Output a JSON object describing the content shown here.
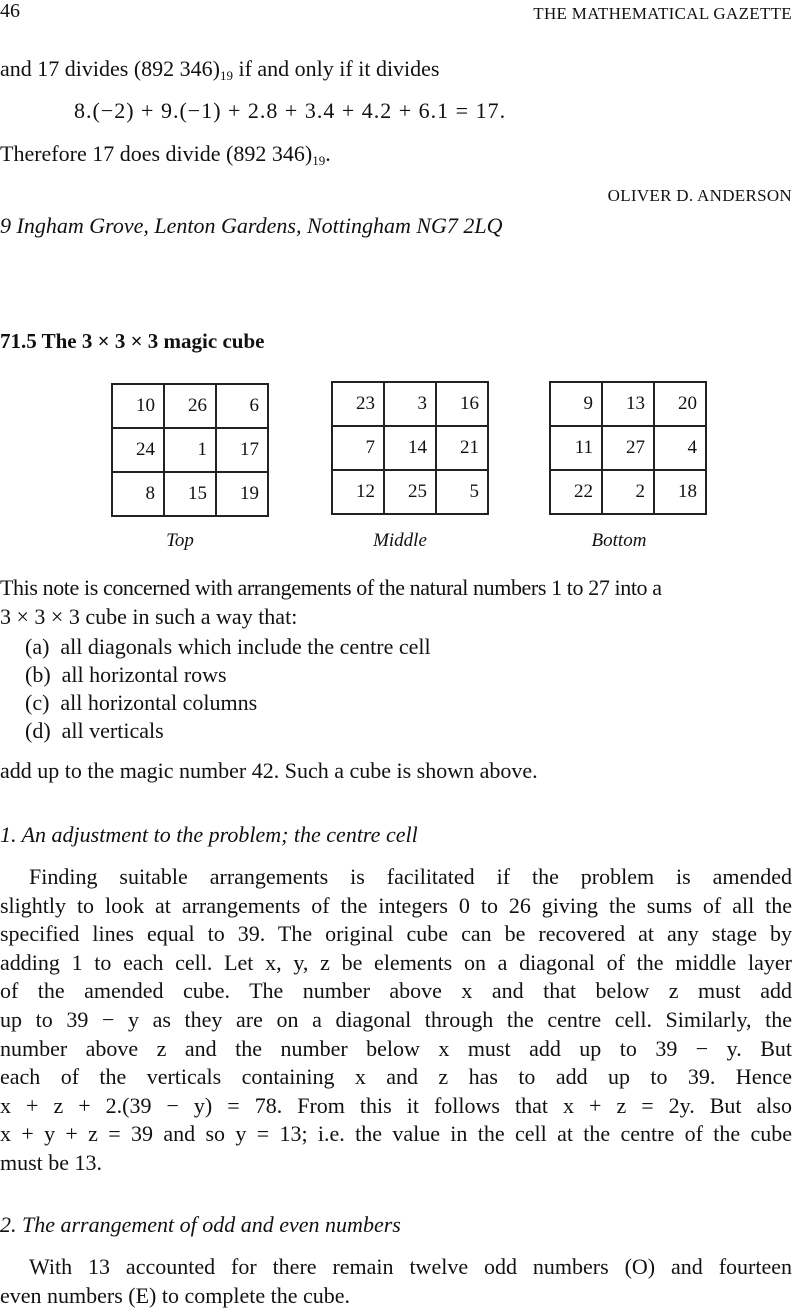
{
  "header": {
    "page_number": "46",
    "journal": "THE MATHEMATICAL GAZETTE"
  },
  "prev_note": {
    "line1_a": "and 17 divides (892 346)",
    "line1_sub": "19",
    "line1_b": " if and only if it divides",
    "equation": "8.(−2) + 9.(−1) + 2.8 + 3.4 + 4.2 + 6.1 = 17.",
    "line3_a": "Therefore 17 does divide (892 346)",
    "line3_sub": "19",
    "line3_b": ".",
    "author": "OLIVER D. ANDERSON",
    "address": "9 Ingham Grove, Lenton Gardens, Nottingham NG7 2LQ"
  },
  "note": {
    "title": "71.5 The 3 × 3 × 3 magic cube",
    "layers": [
      {
        "caption": "Top",
        "cells": [
          [
            "10",
            "26",
            "6"
          ],
          [
            "24",
            "1",
            "17"
          ],
          [
            "8",
            "15",
            "19"
          ]
        ]
      },
      {
        "caption": "Middle",
        "cells": [
          [
            "23",
            "3",
            "16"
          ],
          [
            "7",
            "14",
            "21"
          ],
          [
            "12",
            "25",
            "5"
          ]
        ]
      },
      {
        "caption": "Bottom",
        "cells": [
          [
            "9",
            "13",
            "20"
          ],
          [
            "11",
            "27",
            "4"
          ],
          [
            "22",
            "2",
            "18"
          ]
        ]
      }
    ],
    "intro_1": "This note is concerned with arrangements of the natural numbers 1 to 27 into a",
    "intro_2": "3 × 3 × 3 cube in such a way that:",
    "conditions": [
      {
        "label": "(a)",
        "text": "all diagonals which include the centre cell"
      },
      {
        "label": "(b)",
        "text": "all horizontal rows"
      },
      {
        "label": "(c)",
        "text": "all horizontal columns"
      },
      {
        "label": "(d)",
        "text": "all verticals"
      }
    ],
    "conclusion": "add up to the magic number 42. Such a cube is shown above.",
    "section1": {
      "heading": "1. An adjustment to the problem; the centre cell",
      "lines": [
        "Finding suitable arrangements is facilitated if the problem is amended",
        "slightly to look at arrangements of the integers 0 to 26 giving the sums of all the",
        "specified lines equal to 39. The original cube can be recovered at any stage by",
        "adding 1 to each cell. Let x, y, z be elements on a diagonal of the middle layer",
        "of the amended cube. The number above x and that below z must add",
        "up to 39 − y as they are on a diagonal through the centre cell. Similarly, the",
        "number above z and the number below x must add up to 39 − y. But",
        "each of the verticals containing x and z has to add up to 39. Hence",
        "x + z + 2.(39 − y) = 78. From this it follows that x + z = 2y. But also",
        "x + y + z = 39 and so y = 13; i.e. the value in the cell at the centre of the cube",
        "must be 13."
      ]
    },
    "section2": {
      "heading": "2. The arrangement of odd and even numbers",
      "lines": [
        "With 13 accounted for there remain twelve odd numbers (O) and fourteen",
        "even numbers (E) to complete the cube."
      ]
    }
  }
}
